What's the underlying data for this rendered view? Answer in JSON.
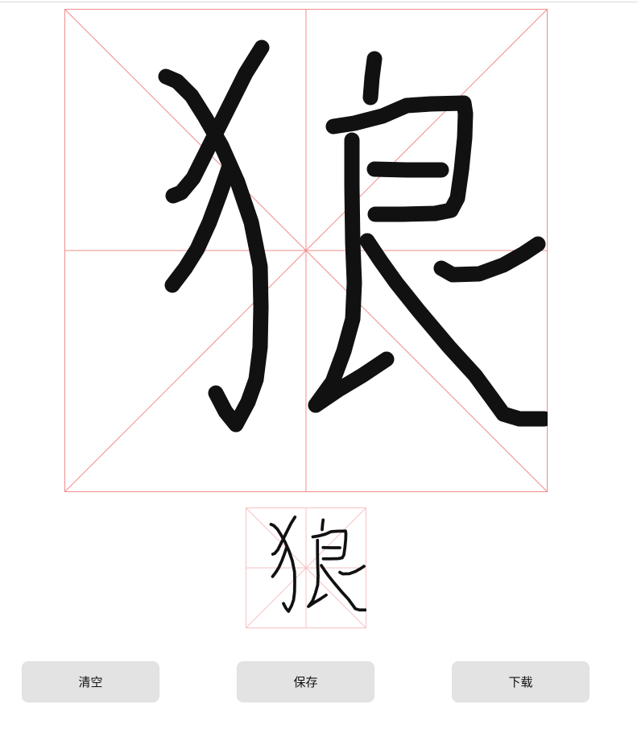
{
  "colors": {
    "grid_line": "#f08c8c",
    "stroke": "#111111",
    "button_bg": "#e3e3e3",
    "button_text": "#111111"
  },
  "writing_area": {
    "character_strokes_icon": "hand-drawn-character-strokes"
  },
  "buttons": {
    "clear_label": "清空",
    "save_label": "保存",
    "download_label": "下载"
  }
}
